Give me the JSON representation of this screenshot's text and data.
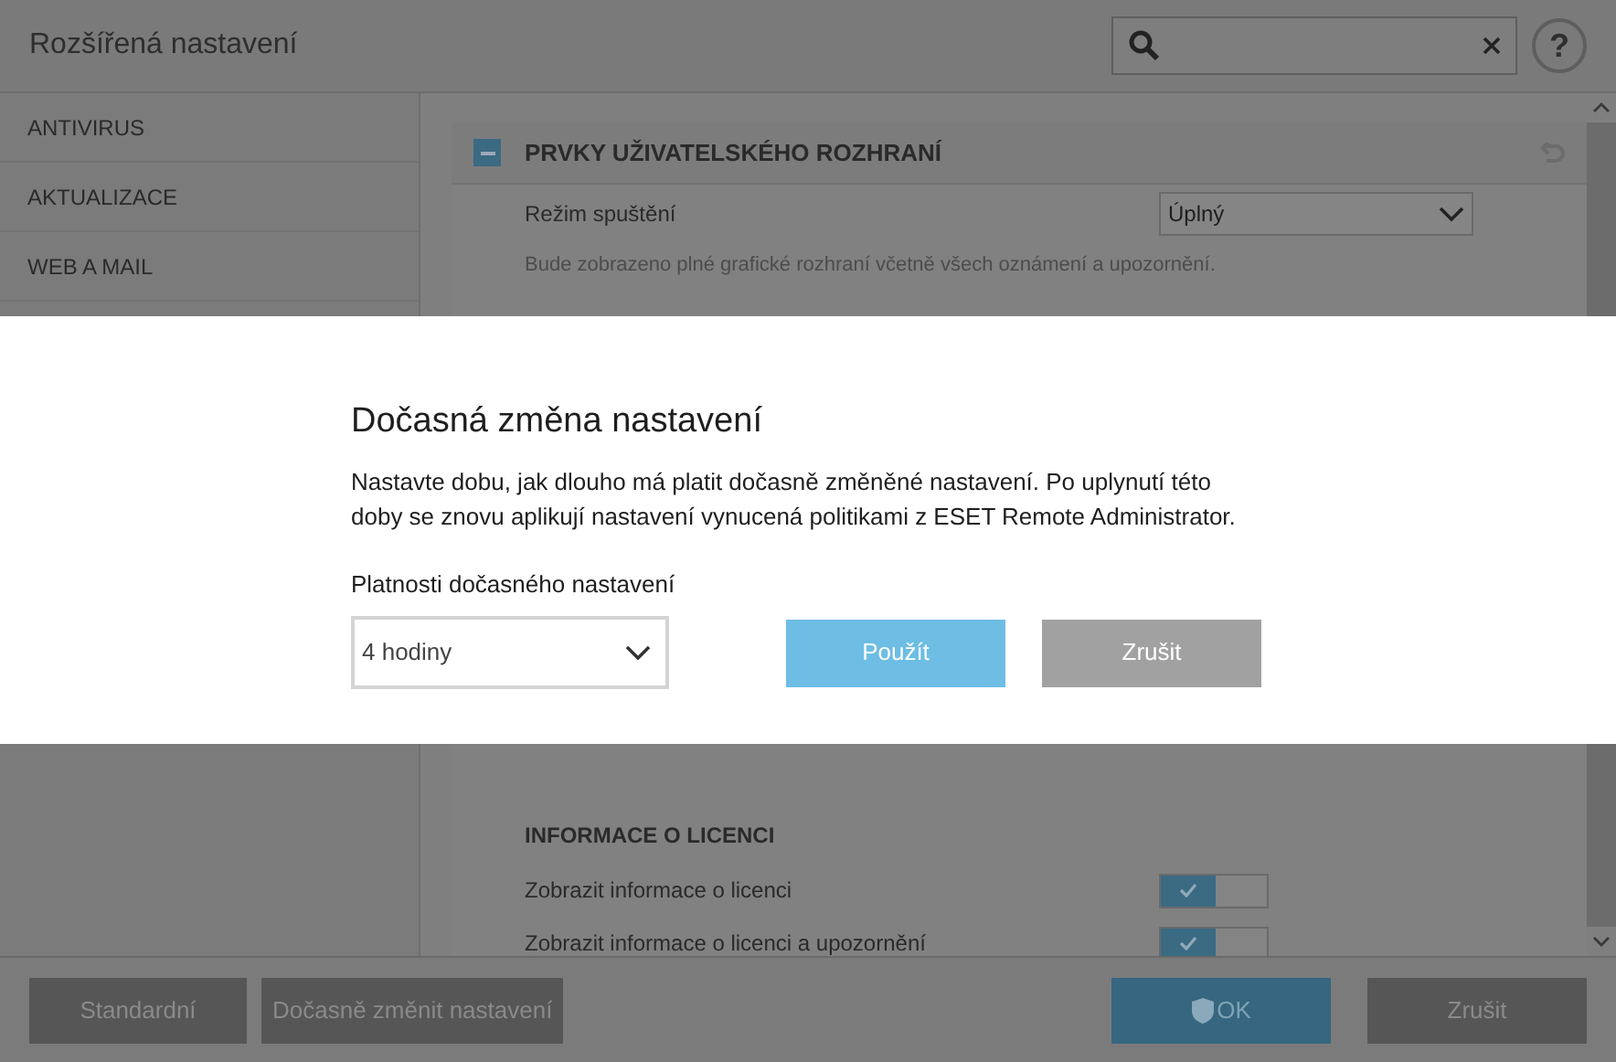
{
  "window": {
    "title": "Rozšířená nastavení",
    "help": "?"
  },
  "sidebar": {
    "items": [
      {
        "label": "ANTIVIRUS"
      },
      {
        "label": "AKTUALIZACE"
      },
      {
        "label": "WEB A MAIL"
      }
    ]
  },
  "section": {
    "title": "PRVKY UŽIVATELSKÉHO ROZHRANÍ",
    "expanded": true,
    "mode_label": "Režim spuštění",
    "mode_value": "Úplný",
    "description": "Bude zobrazeno plné grafické rozhraní včetně všech oznámení a upozornění."
  },
  "license": {
    "title": "INFORMACE O LICENCI",
    "toggles": [
      {
        "label": "Zobrazit informace o licenci",
        "on": true
      },
      {
        "label": "Zobrazit informace o licenci a upozornění",
        "on": true
      }
    ]
  },
  "footer": {
    "buttons": [
      {
        "label": "Standardní",
        "kind": "plain"
      },
      {
        "label": "Dočasně změnit nastavení",
        "kind": "plain"
      },
      {
        "label": "OK",
        "kind": "primary"
      },
      {
        "label": "Zrušit",
        "kind": "plain"
      }
    ]
  },
  "dialog": {
    "title": "Dočasná změna nastavení",
    "text": "Nastavte dobu, jak dlouho má platit dočasně změněné nastavení. Po uplynutí této doby se znovu aplikují nastavení vynucená politikami z ESET Remote Administrator.",
    "field_label": "Platnosti dočasného nastavení",
    "field_value": "4 hodiny",
    "buttons": [
      {
        "label": "Použít",
        "kind": "primary"
      },
      {
        "label": "Zrušit",
        "kind": "plain"
      }
    ]
  }
}
